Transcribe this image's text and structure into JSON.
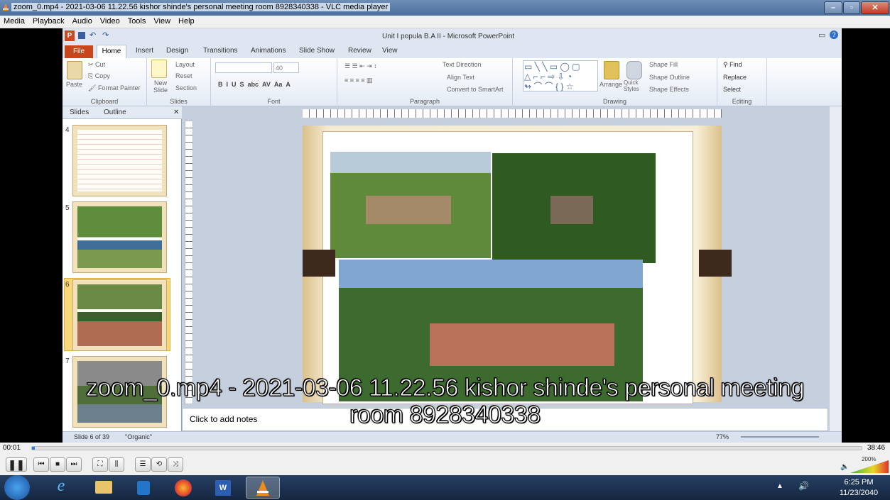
{
  "window": {
    "title": "zoom_0.mp4 - 2021-03-06 11.22.56 kishor shinde's personal meeting room 8928340338 - VLC media player"
  },
  "menu": [
    "Media",
    "Playback",
    "Audio",
    "Video",
    "Tools",
    "View",
    "Help"
  ],
  "powerpoint": {
    "title": "Unit I popula B.A II - Microsoft PowerPoint",
    "tabs": [
      "File",
      "Home",
      "Insert",
      "Design",
      "Transitions",
      "Animations",
      "Slide Show",
      "Review",
      "View"
    ],
    "groups": {
      "clipboard": {
        "label": "Clipboard",
        "paste": "Paste",
        "cut": "Cut",
        "copy": "Copy",
        "format_painter": "Format Painter"
      },
      "slides": {
        "label": "Slides",
        "new_slide": "New Slide",
        "layout": "Layout",
        "reset": "Reset",
        "section": "Section"
      },
      "font": {
        "label": "Font",
        "size": "40"
      },
      "paragraph": {
        "label": "Paragraph",
        "text_direction": "Text Direction",
        "align_text": "Align Text",
        "convert": "Convert to SmartArt"
      },
      "drawing": {
        "label": "Drawing",
        "arrange": "Arrange",
        "quick_styles": "Quick Styles",
        "shape_fill": "Shape Fill",
        "shape_outline": "Shape Outline",
        "shape_effects": "Shape Effects"
      },
      "editing": {
        "label": "Editing",
        "find": "Find",
        "replace": "Replace",
        "select": "Select"
      }
    },
    "pane_tabs": [
      "Slides",
      "Outline"
    ],
    "slide_numbers": [
      "4",
      "5",
      "6",
      "7"
    ],
    "notes_placeholder": "Click to add notes",
    "status": {
      "slide": "Slide 6 of 39",
      "theme": "\"Organic\"",
      "zoom": "77%"
    }
  },
  "subtitle": {
    "line1": "zoom_0.mp4 - 2021-03-06 11.22.56 kishor shinde's personal meeting",
    "line2": "room 8928340338"
  },
  "player": {
    "current_time": "00:01",
    "total_time": "38:46",
    "volume_label": "200%",
    "progress": 0.0004
  },
  "taskbar": {
    "time": "6:25 PM",
    "date": "11/23/2040"
  }
}
